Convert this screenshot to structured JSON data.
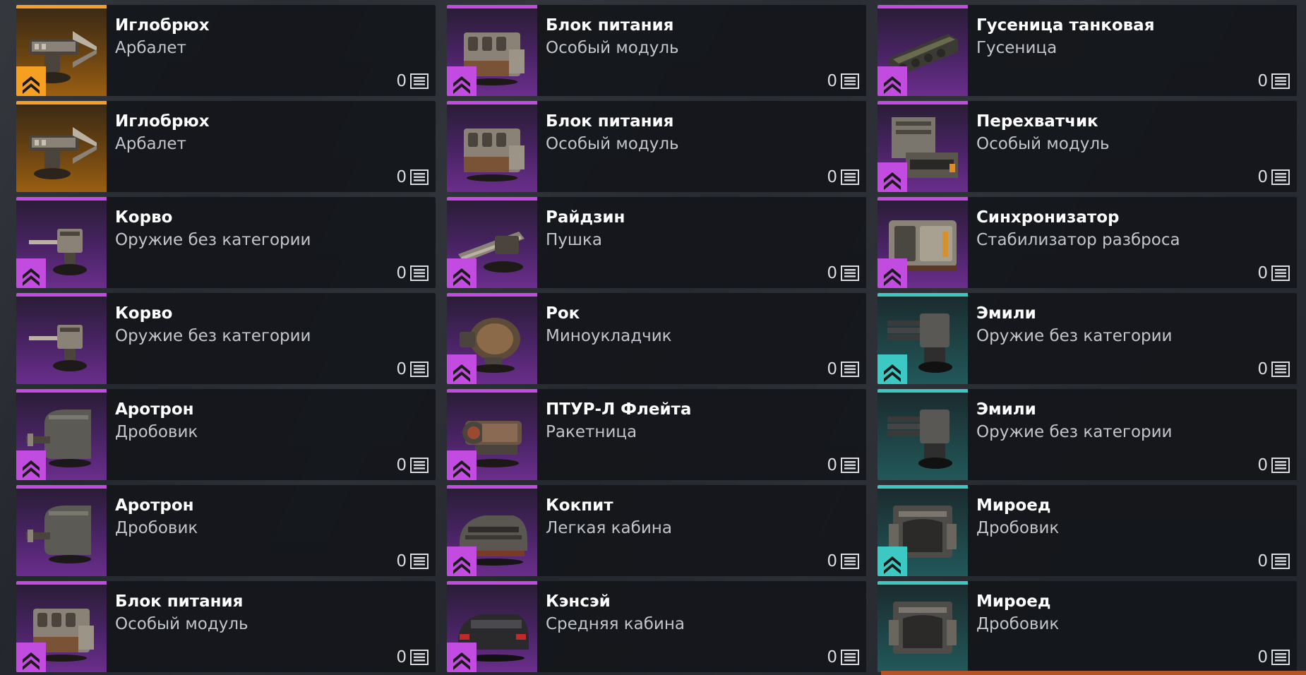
{
  "colors": {
    "legendary": "#f5a023",
    "epic": "#c24be0",
    "rare": "#3cc9c4"
  },
  "columns": [
    {
      "items": [
        {
          "name": "Иглобрюх",
          "category": "Арбалет",
          "count": "0",
          "rarity": "legendary",
          "art": "crossbow",
          "rank_badge": true
        },
        {
          "name": "Иглобрюх",
          "category": "Арбалет",
          "count": "0",
          "rarity": "legendary",
          "art": "crossbow",
          "rank_badge": false
        },
        {
          "name": "Корво",
          "category": "Оружие без категории",
          "count": "0",
          "rarity": "epic",
          "art": "turret-gun",
          "rank_badge": true
        },
        {
          "name": "Корво",
          "category": "Оружие без категории",
          "count": "0",
          "rarity": "epic",
          "art": "turret-gun",
          "rank_badge": false
        },
        {
          "name": "Аротрон",
          "category": "Дробовик",
          "count": "0",
          "rarity": "epic",
          "art": "dome-gun",
          "rank_badge": true
        },
        {
          "name": "Аротрон",
          "category": "Дробовик",
          "count": "0",
          "rarity": "epic",
          "art": "dome-gun",
          "rank_badge": false
        },
        {
          "name": "Блок питания",
          "category": "Особый модуль",
          "count": "0",
          "rarity": "epic",
          "art": "power-box",
          "rank_badge": true
        }
      ]
    },
    {
      "items": [
        {
          "name": "Блок питания",
          "category": "Особый модуль",
          "count": "0",
          "rarity": "epic",
          "art": "power-box",
          "rank_badge": true
        },
        {
          "name": "Блок питания",
          "category": "Особый модуль",
          "count": "0",
          "rarity": "epic",
          "art": "power-box",
          "rank_badge": false
        },
        {
          "name": "Райдзин",
          "category": "Пушка",
          "count": "0",
          "rarity": "epic",
          "art": "cannon",
          "rank_badge": true
        },
        {
          "name": "Рок",
          "category": "Миноукладчик",
          "count": "0",
          "rarity": "epic",
          "art": "mine-layer",
          "rank_badge": true
        },
        {
          "name": "ПТУР-Л Флейта",
          "category": "Ракетница",
          "count": "0",
          "rarity": "epic",
          "art": "launcher",
          "rank_badge": true
        },
        {
          "name": "Кокпит",
          "category": "Легкая кабина",
          "count": "0",
          "rarity": "epic",
          "art": "cabin-light",
          "rank_badge": true
        },
        {
          "name": "Кэнсэй",
          "category": "Средняя кабина",
          "count": "0",
          "rarity": "epic",
          "art": "cabin-medium",
          "rank_badge": true
        }
      ]
    },
    {
      "items": [
        {
          "name": "Гусеница танковая",
          "category": "Гусеница",
          "count": "0",
          "rarity": "epic",
          "art": "track",
          "rank_badge": true
        },
        {
          "name": "Перехватчик",
          "category": "Особый модуль",
          "count": "0",
          "rarity": "epic",
          "art": "interceptor",
          "rank_badge": true
        },
        {
          "name": "Синхронизатор",
          "category": "Стабилизатор разброса",
          "count": "0",
          "rarity": "epic",
          "art": "sync-box",
          "rank_badge": true
        },
        {
          "name": "Эмили",
          "category": "Оружие без категории",
          "count": "0",
          "rarity": "rare",
          "art": "gatling",
          "rank_badge": true
        },
        {
          "name": "Эмили",
          "category": "Оружие без категории",
          "count": "0",
          "rarity": "rare",
          "art": "gatling",
          "rank_badge": false
        },
        {
          "name": "Мироед",
          "category": "Дробовик",
          "count": "0",
          "rarity": "rare",
          "art": "shotgun-box",
          "rank_badge": true
        },
        {
          "name": "Мироед",
          "category": "Дробовик",
          "count": "0",
          "rarity": "rare",
          "art": "shotgun-box",
          "rank_badge": false
        }
      ]
    }
  ]
}
